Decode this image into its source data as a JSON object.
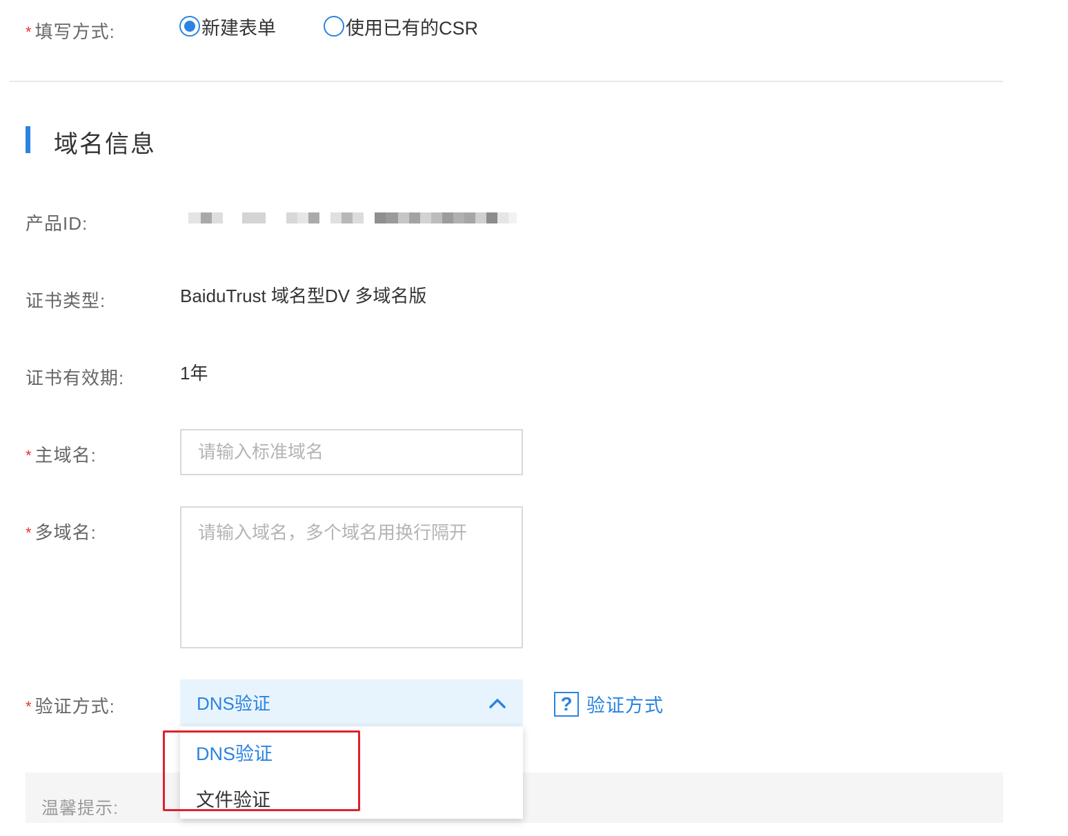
{
  "fill_method": {
    "label": "填写方式:",
    "options": [
      {
        "label": "新建表单",
        "checked": true
      },
      {
        "label": "使用已有的CSR",
        "checked": false
      }
    ]
  },
  "section": {
    "title": "域名信息"
  },
  "product_id": {
    "label": "产品ID:"
  },
  "cert_type": {
    "label": "证书类型:",
    "value": "BaiduTrust 域名型DV 多域名版"
  },
  "validity": {
    "label": "证书有效期:",
    "value": "1年"
  },
  "main_domain": {
    "label": "主域名:",
    "placeholder": "请输入标准域名"
  },
  "multi_domain": {
    "label": "多域名:",
    "placeholder": "请输入域名，多个域名用换行隔开"
  },
  "verify": {
    "label": "验证方式:",
    "selected": "DNS验证",
    "help_label": "验证方式",
    "help_icon": "question-icon",
    "options": [
      "DNS验证",
      "文件验证"
    ]
  },
  "tip": {
    "label": "温馨提示:"
  },
  "colors": {
    "accent": "#2a83e0",
    "required": "#e8312f",
    "highlight": "#e0202a"
  }
}
